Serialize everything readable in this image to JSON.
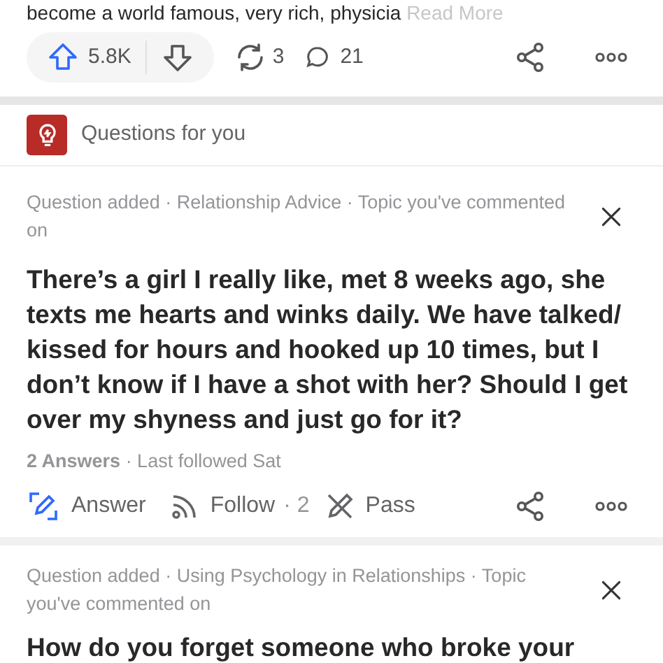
{
  "previous_post": {
    "snippet": "become a world famous, very rich, physicia",
    "read_more": "Read More",
    "upvotes": "5.8K",
    "upvoted": true,
    "shares": "3",
    "comments": "21"
  },
  "section": {
    "title": "Questions for you"
  },
  "questions": [
    {
      "meta": "Question added · Relationship Advice · Topic you've commented on",
      "title": "There’s a girl I really like, met 8 weeks ago, she texts me hearts and winks daily. We have talked/ kissed for hours and hooked up 10 times, but I don’t know if I have a shot with her? Should I get over my shyness and just go for it?",
      "answers": "2 Answers",
      "followed": "· Last followed Sat",
      "answer_label": "Answer",
      "follow_label": "Follow",
      "follow_count": "· 2",
      "pass_label": "Pass"
    },
    {
      "meta": "Question added · Using Psychology in Relationships · Topic you've commented on",
      "title": "How do you forget someone who broke your"
    }
  ]
}
